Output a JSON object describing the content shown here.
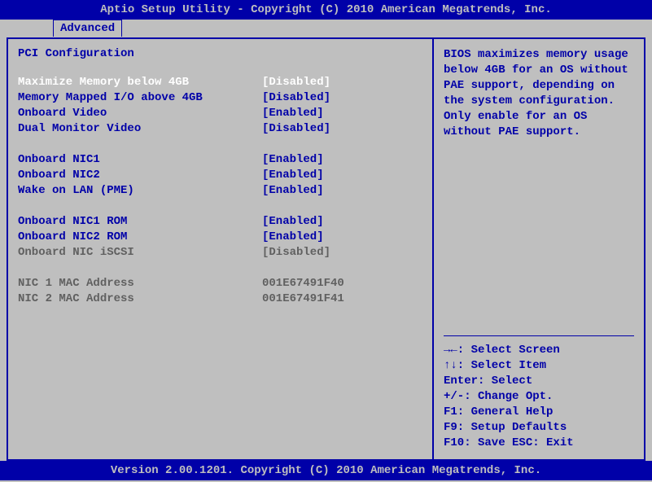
{
  "header": {
    "title": "Aptio Setup Utility - Copyright (C) 2010 American Megatrends, Inc."
  },
  "tab": {
    "active": "Advanced"
  },
  "section": {
    "title": "PCI Configuration"
  },
  "settings": [
    {
      "label": "Maximize Memory below 4GB",
      "value": "[Disabled]",
      "state": "selected"
    },
    {
      "label": "Memory Mapped I/O above 4GB",
      "value": "[Disabled]",
      "state": "normal"
    },
    {
      "label": "Onboard Video",
      "value": "[Enabled]",
      "state": "normal"
    },
    {
      "label": "Dual Monitor Video",
      "value": "[Disabled]",
      "state": "normal"
    },
    {
      "label": "",
      "value": "",
      "state": "spacer"
    },
    {
      "label": "Onboard NIC1",
      "value": "[Enabled]",
      "state": "normal"
    },
    {
      "label": "Onboard NIC2",
      "value": "[Enabled]",
      "state": "normal"
    },
    {
      "label": "Wake on LAN (PME)",
      "value": "[Enabled]",
      "state": "normal"
    },
    {
      "label": "",
      "value": "",
      "state": "spacer"
    },
    {
      "label": "Onboard NIC1 ROM",
      "value": "[Enabled]",
      "state": "normal"
    },
    {
      "label": "Onboard NIC2 ROM",
      "value": "[Enabled]",
      "state": "normal"
    },
    {
      "label": "Onboard NIC iSCSI",
      "value": "[Disabled]",
      "state": "disabled"
    },
    {
      "label": "",
      "value": "",
      "state": "spacer"
    },
    {
      "label": "NIC 1 MAC Address",
      "value": "001E67491F40",
      "state": "disabled"
    },
    {
      "label": "NIC 2 MAC Address",
      "value": "001E67491F41",
      "state": "disabled"
    }
  ],
  "help": {
    "text": "BIOS maximizes memory usage below 4GB for an OS without PAE support, depending on the system configuration. Only enable for an OS without PAE support."
  },
  "keys": [
    "→←: Select Screen",
    "↑↓: Select Item",
    "Enter: Select",
    "+/-: Change Opt.",
    "F1: General Help",
    "F9: Setup Defaults",
    "F10: Save  ESC: Exit"
  ],
  "footer": {
    "text": "Version 2.00.1201. Copyright (C) 2010 American Megatrends, Inc."
  }
}
